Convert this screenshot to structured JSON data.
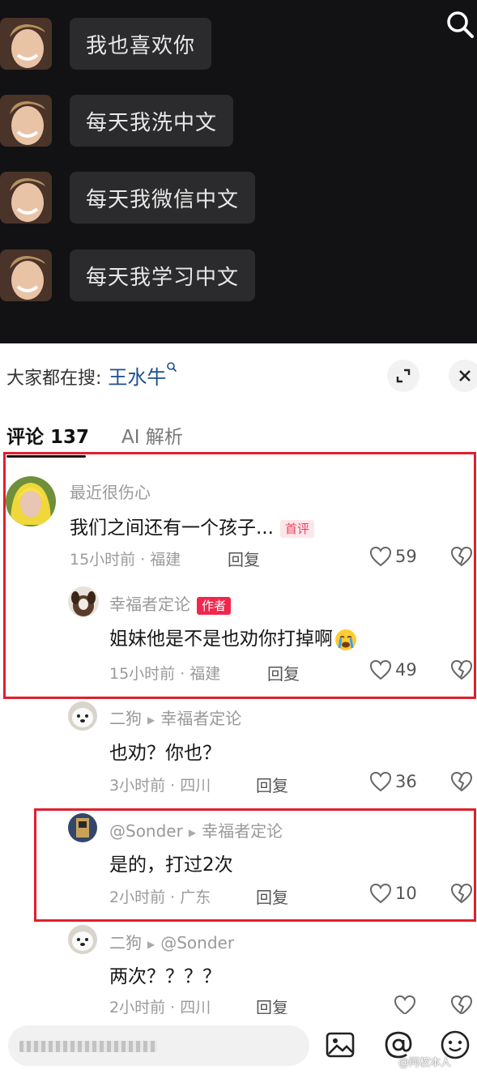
{
  "video": {
    "lines": [
      "我也喜欢你",
      "每天我洗中文",
      "每天我微信中文",
      "每天我学习中文"
    ]
  },
  "search_suggest": {
    "label": "大家都在搜:",
    "keyword": "王水牛"
  },
  "tabs": [
    {
      "label": "评论 137",
      "active": true
    },
    {
      "label": "AI 解析",
      "active": false
    }
  ],
  "comments": [
    {
      "user": "最近很伤心",
      "text": "我们之间还有一个孩子...",
      "badge": "首评",
      "meta": "15小时前 · 福建",
      "reply": "回复",
      "likes": "59"
    },
    {
      "user": "幸福者定论",
      "badge": "作者",
      "text": "姐妹他是不是也劝你打掉啊",
      "meta": "15小时前 · 福建",
      "reply": "回复",
      "likes": "49"
    },
    {
      "user": "二狗",
      "reply_to": "幸福者定论",
      "text": "也劝？你也？",
      "meta": "3小时前 · 四川",
      "reply": "回复",
      "likes": "36"
    },
    {
      "user": "@Sonder",
      "reply_to": "幸福者定论",
      "text": "是的，打过2次",
      "meta": "2小时前 · 广东",
      "reply": "回复",
      "likes": "10"
    },
    {
      "user": "二狗",
      "reply_to": "@Sonder",
      "text": "两次？？？？",
      "meta": "2小时前 · 四川",
      "reply": "回复"
    }
  ],
  "watermark": "@阿权本人",
  "colors": {
    "highlight_box": "#e01f2d",
    "author_badge": "#f2264d",
    "keyword": "#1c4f8e"
  }
}
